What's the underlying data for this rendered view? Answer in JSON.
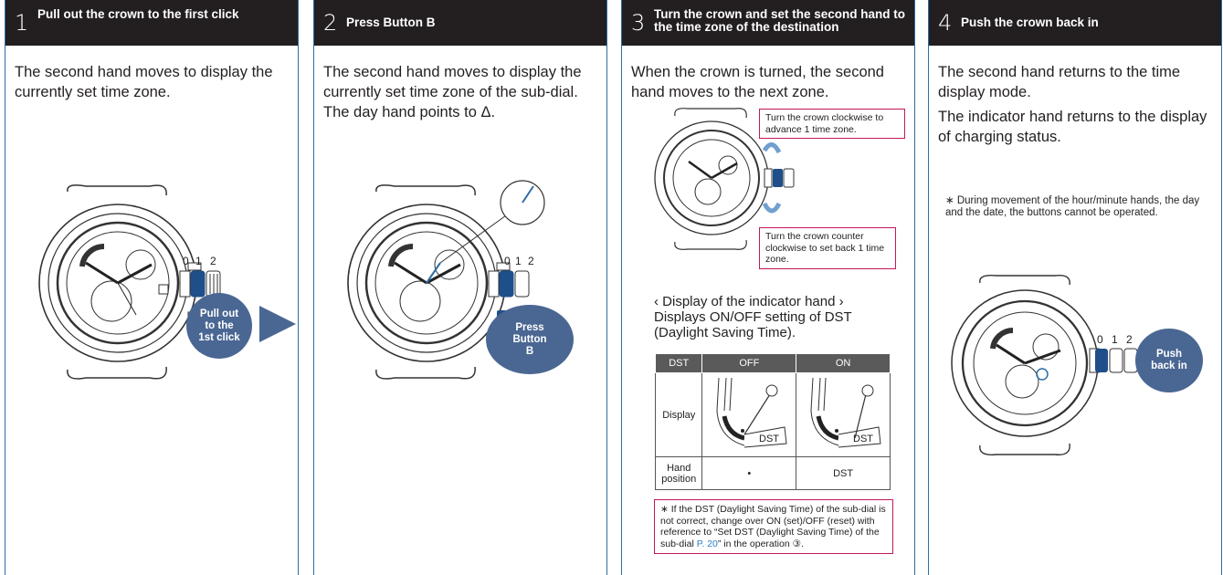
{
  "panels": [
    {
      "number": "1",
      "title": "Pull out the crown to the first click",
      "body": "The second hand moves to display the currently set time zone.",
      "badge": "Pull out to the 1st click",
      "crown_positions": [
        "0",
        "1",
        "2"
      ]
    },
    {
      "number": "2",
      "title": "Press Button B",
      "body": "The second hand moves to display the currently set time zone of the sub-dial. The day hand points to Δ.",
      "badge": "Press Button B",
      "crown_positions": [
        "0",
        "1",
        "2"
      ]
    },
    {
      "number": "3",
      "title": "Turn the crown and set the second hand to the time zone of the destination",
      "body": "When the crown is turned, the second hand moves to the next zone.",
      "callout_cw": "Turn the crown clockwise to advance 1 time zone.",
      "callout_ccw": "Turn the crown counter clockwise to set back 1 time zone.",
      "indicator_heading": "‹ Display of the indicator hand ›",
      "indicator_desc": "Displays ON/OFF setting of DST (Daylight Saving Time).",
      "table": {
        "headers": [
          "DST",
          "OFF",
          "ON"
        ],
        "row1_label": "Display",
        "row2_label": "Hand position",
        "row2_off": "•",
        "row2_on": "DST",
        "dial_label": "DST"
      },
      "footnote_pre": "∗ If the DST (Daylight Saving Time) of the sub-dial is not correct, change over ON (set)/OFF (reset) with reference to “Set DST (Daylight Saving Time) of the sub-dial ",
      "footnote_link": "P. 20",
      "footnote_post": "” in the operation ③."
    },
    {
      "number": "4",
      "title": "Push the crown back in",
      "body1": "The second hand returns to the time display mode.",
      "body2": "The indicator hand returns to the display of charging status.",
      "note": "∗ During movement of the hour/minute hands, the day and the date, the buttons cannot be operated.",
      "badge": "Push back in",
      "crown_positions": [
        "0",
        "1",
        "2"
      ]
    }
  ],
  "colors": {
    "header": "#231f20",
    "accent_blue": "#4a6793",
    "border": "#2e6da4",
    "callout": "#c2185b",
    "link": "#2a7fc4"
  }
}
